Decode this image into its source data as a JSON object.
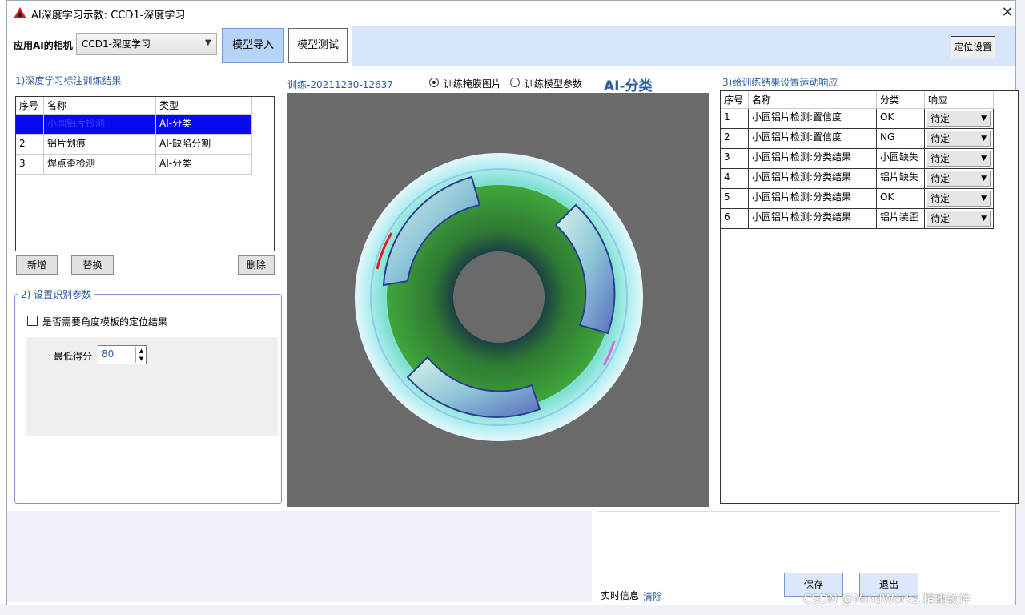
{
  "window": {
    "title": "AI深度学习示教: CCD1-深度学习"
  },
  "top_bar": {
    "camera_label": "应用AI的相机",
    "camera_select": "CCD1-深度学习",
    "tab_model_import": "模型导入",
    "tab_model_test": "模型测试",
    "locate_settings": "定位设置"
  },
  "left": {
    "section1_title": "1)深度学习标注训练结果",
    "table_headers": [
      "序号",
      "名称",
      "类型"
    ],
    "rows": [
      {
        "no": "1",
        "name": "小圆铝片检测",
        "type": "AI-分类"
      },
      {
        "no": "2",
        "name": "铝片划痕",
        "type": "AI-缺陷分割"
      },
      {
        "no": "3",
        "name": "焊点歪检测",
        "type": "AI-分类"
      }
    ],
    "add_button": "新增",
    "replace_button": "替换",
    "delete_button": "删除",
    "section2_title": "2) 设置识别参数",
    "angle_checkbox_label": "是否需要角度模板的定位结果",
    "angle_checkbox_checked": false,
    "min_score_label": "最低得分",
    "min_score_value": "80"
  },
  "center": {
    "train_id": "训练-20211230-12637",
    "radio_mask_label": "训练掩膜图片",
    "radio_params_label": "训练模型参数",
    "selected_radio": "训练掩膜图片",
    "ai_class_label": "AI-分类"
  },
  "right": {
    "section3_title": "3)给训练结果设置运动响应",
    "table_headers": [
      "序号",
      "名称",
      "分类",
      "响应"
    ],
    "rows": [
      {
        "no": "1",
        "name": "小圆铝片检测:置信度",
        "class": "OK",
        "response": "待定"
      },
      {
        "no": "2",
        "name": "小圆铝片检测:置信度",
        "class": "NG",
        "response": "待定"
      },
      {
        "no": "3",
        "name": "小圆铝片检测:分类结果",
        "class": "小圆缺失",
        "response": "待定"
      },
      {
        "no": "4",
        "name": "小圆铝片检测:分类结果",
        "class": "铝片缺失",
        "response": "待定"
      },
      {
        "no": "5",
        "name": "小圆铝片检测:分类结果",
        "class": "OK",
        "response": "待定"
      },
      {
        "no": "6",
        "name": "小圆铝片检测:分类结果",
        "class": "铝片装歪",
        "response": "待定"
      }
    ]
  },
  "bottom": {
    "realtime_label": "实时信息",
    "clear_link": "清除",
    "save_button": "保存",
    "exit_button": "退出"
  },
  "watermark": "CSDN @MindWorks.精驰软件",
  "colors": {
    "accent_blue": "#2b5aa6",
    "selection": "#0a0af0",
    "tab_active": "#b6d4f7",
    "image_bg": "#6a6a6a"
  }
}
